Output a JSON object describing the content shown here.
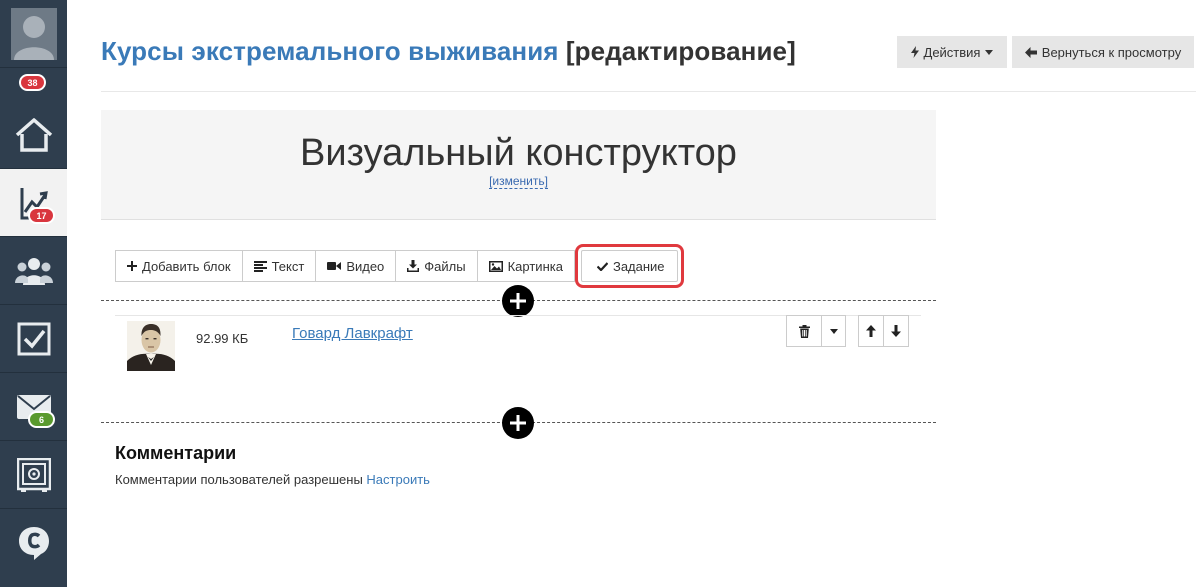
{
  "sidebar": {
    "avatar_badge": "38",
    "dashboard_badge": "17",
    "mail_badge": "6",
    "items": [
      {
        "name": "user-avatar-icon"
      },
      {
        "name": "home-icon"
      },
      {
        "name": "chart-icon"
      },
      {
        "name": "users-icon"
      },
      {
        "name": "tasks-checkbox-icon"
      },
      {
        "name": "mail-icon"
      },
      {
        "name": "safe-icon"
      },
      {
        "name": "chat-logo-icon"
      }
    ]
  },
  "header": {
    "title": "Курсы экстремального выживания",
    "title_suffix": "[редактирование]",
    "actions_label": "Действия",
    "back_label": "Вернуться к просмотру"
  },
  "constructor": {
    "title": "Визуальный конструктор",
    "change_link": "[изменить]"
  },
  "toolbar": {
    "add_block": "Добавить блок",
    "text": "Текст",
    "video": "Видео",
    "files": "Файлы",
    "image": "Картинка",
    "task": "Задание"
  },
  "file_block": {
    "size": "92.99 КБ",
    "name": "Говард Лавкрафт"
  },
  "comments": {
    "title": "Комментарии",
    "text": "Комментарии пользователей разрешены",
    "configure_link": "Настроить"
  },
  "colors": {
    "sidebar_bg": "#2f3e4e",
    "accent_link": "#3a7ab8",
    "highlight": "#e0393e",
    "badge_red": "#d9363e",
    "badge_green": "#5a9a2e"
  }
}
